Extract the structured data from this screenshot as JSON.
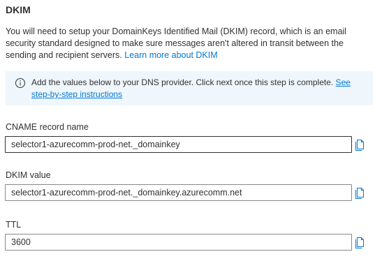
{
  "section": {
    "title": "DKIM",
    "description": "You will need to setup your DomainKeys Identified Mail (DKIM) record, which is an email security standard designed to make sure messages aren't altered in transit between the sending and recipient servers.",
    "learn_more_link": "Learn more about DKIM"
  },
  "info_bar": {
    "icon": "info-icon",
    "message": "Add the values below to your DNS provider. Click next once this step is complete.",
    "link": "See step-by-step instructions"
  },
  "fields": [
    {
      "label": "CNAME record name",
      "value": "selector1-azurecomm-prod-net._domainkey",
      "copy_icon": "copy-icon"
    },
    {
      "label": "DKIM value",
      "value": "selector1-azurecomm-prod-net._domainkey.azurecomm.net",
      "copy_icon": "copy-icon"
    },
    {
      "label": "TTL",
      "value": "3600",
      "copy_icon": "copy-icon"
    }
  ],
  "colors": {
    "link": "#0078d4",
    "info_background": "#eff6fc",
    "text": "#323130",
    "input_border": "#8a8886"
  }
}
